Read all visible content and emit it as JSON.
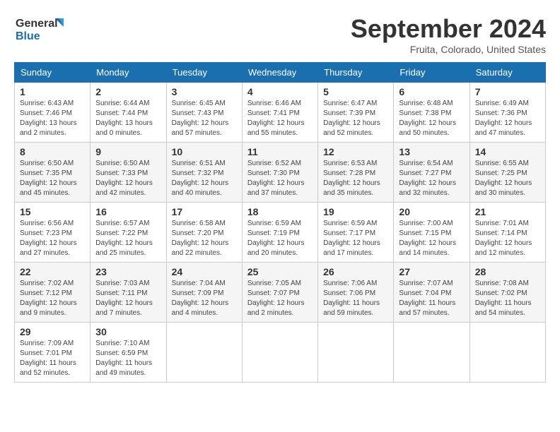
{
  "header": {
    "logo_line1": "General",
    "logo_line2": "Blue",
    "month": "September 2024",
    "location": "Fruita, Colorado, United States"
  },
  "weekdays": [
    "Sunday",
    "Monday",
    "Tuesday",
    "Wednesday",
    "Thursday",
    "Friday",
    "Saturday"
  ],
  "weeks": [
    [
      {
        "day": "1",
        "info": "Sunrise: 6:43 AM\nSunset: 7:46 PM\nDaylight: 13 hours\nand 2 minutes."
      },
      {
        "day": "2",
        "info": "Sunrise: 6:44 AM\nSunset: 7:44 PM\nDaylight: 13 hours\nand 0 minutes."
      },
      {
        "day": "3",
        "info": "Sunrise: 6:45 AM\nSunset: 7:43 PM\nDaylight: 12 hours\nand 57 minutes."
      },
      {
        "day": "4",
        "info": "Sunrise: 6:46 AM\nSunset: 7:41 PM\nDaylight: 12 hours\nand 55 minutes."
      },
      {
        "day": "5",
        "info": "Sunrise: 6:47 AM\nSunset: 7:39 PM\nDaylight: 12 hours\nand 52 minutes."
      },
      {
        "day": "6",
        "info": "Sunrise: 6:48 AM\nSunset: 7:38 PM\nDaylight: 12 hours\nand 50 minutes."
      },
      {
        "day": "7",
        "info": "Sunrise: 6:49 AM\nSunset: 7:36 PM\nDaylight: 12 hours\nand 47 minutes."
      }
    ],
    [
      {
        "day": "8",
        "info": "Sunrise: 6:50 AM\nSunset: 7:35 PM\nDaylight: 12 hours\nand 45 minutes."
      },
      {
        "day": "9",
        "info": "Sunrise: 6:50 AM\nSunset: 7:33 PM\nDaylight: 12 hours\nand 42 minutes."
      },
      {
        "day": "10",
        "info": "Sunrise: 6:51 AM\nSunset: 7:32 PM\nDaylight: 12 hours\nand 40 minutes."
      },
      {
        "day": "11",
        "info": "Sunrise: 6:52 AM\nSunset: 7:30 PM\nDaylight: 12 hours\nand 37 minutes."
      },
      {
        "day": "12",
        "info": "Sunrise: 6:53 AM\nSunset: 7:28 PM\nDaylight: 12 hours\nand 35 minutes."
      },
      {
        "day": "13",
        "info": "Sunrise: 6:54 AM\nSunset: 7:27 PM\nDaylight: 12 hours\nand 32 minutes."
      },
      {
        "day": "14",
        "info": "Sunrise: 6:55 AM\nSunset: 7:25 PM\nDaylight: 12 hours\nand 30 minutes."
      }
    ],
    [
      {
        "day": "15",
        "info": "Sunrise: 6:56 AM\nSunset: 7:23 PM\nDaylight: 12 hours\nand 27 minutes."
      },
      {
        "day": "16",
        "info": "Sunrise: 6:57 AM\nSunset: 7:22 PM\nDaylight: 12 hours\nand 25 minutes."
      },
      {
        "day": "17",
        "info": "Sunrise: 6:58 AM\nSunset: 7:20 PM\nDaylight: 12 hours\nand 22 minutes."
      },
      {
        "day": "18",
        "info": "Sunrise: 6:59 AM\nSunset: 7:19 PM\nDaylight: 12 hours\nand 20 minutes."
      },
      {
        "day": "19",
        "info": "Sunrise: 6:59 AM\nSunset: 7:17 PM\nDaylight: 12 hours\nand 17 minutes."
      },
      {
        "day": "20",
        "info": "Sunrise: 7:00 AM\nSunset: 7:15 PM\nDaylight: 12 hours\nand 14 minutes."
      },
      {
        "day": "21",
        "info": "Sunrise: 7:01 AM\nSunset: 7:14 PM\nDaylight: 12 hours\nand 12 minutes."
      }
    ],
    [
      {
        "day": "22",
        "info": "Sunrise: 7:02 AM\nSunset: 7:12 PM\nDaylight: 12 hours\nand 9 minutes."
      },
      {
        "day": "23",
        "info": "Sunrise: 7:03 AM\nSunset: 7:11 PM\nDaylight: 12 hours\nand 7 minutes."
      },
      {
        "day": "24",
        "info": "Sunrise: 7:04 AM\nSunset: 7:09 PM\nDaylight: 12 hours\nand 4 minutes."
      },
      {
        "day": "25",
        "info": "Sunrise: 7:05 AM\nSunset: 7:07 PM\nDaylight: 12 hours\nand 2 minutes."
      },
      {
        "day": "26",
        "info": "Sunrise: 7:06 AM\nSunset: 7:06 PM\nDaylight: 11 hours\nand 59 minutes."
      },
      {
        "day": "27",
        "info": "Sunrise: 7:07 AM\nSunset: 7:04 PM\nDaylight: 11 hours\nand 57 minutes."
      },
      {
        "day": "28",
        "info": "Sunrise: 7:08 AM\nSunset: 7:02 PM\nDaylight: 11 hours\nand 54 minutes."
      }
    ],
    [
      {
        "day": "29",
        "info": "Sunrise: 7:09 AM\nSunset: 7:01 PM\nDaylight: 11 hours\nand 52 minutes."
      },
      {
        "day": "30",
        "info": "Sunrise: 7:10 AM\nSunset: 6:59 PM\nDaylight: 11 hours\nand 49 minutes."
      },
      {
        "day": "",
        "info": ""
      },
      {
        "day": "",
        "info": ""
      },
      {
        "day": "",
        "info": ""
      },
      {
        "day": "",
        "info": ""
      },
      {
        "day": "",
        "info": ""
      }
    ]
  ]
}
